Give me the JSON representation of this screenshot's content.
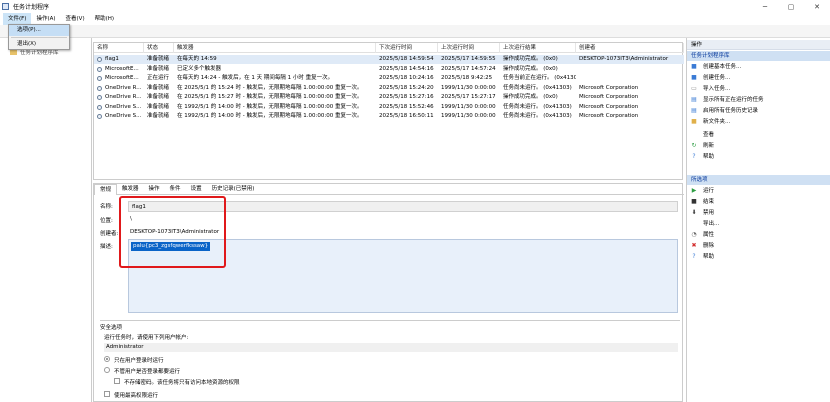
{
  "window": {
    "title": "任务计划程序"
  },
  "menubar": {
    "items": [
      "文件(F)",
      "操作(A)",
      "查看(V)",
      "帮助(H)"
    ]
  },
  "file_menu": {
    "items": [
      "选项(P)...",
      "退出(X)"
    ]
  },
  "tree": {
    "root": "任务计划程序库"
  },
  "tasklist": {
    "columns": [
      "名称",
      "状态",
      "触发器",
      "下次运行时间",
      "上次运行时间",
      "上次运行结果",
      "创建者"
    ],
    "rows": [
      [
        "flag1",
        "准备就绪",
        "在每天的 14:59",
        "2025/5/18 14:59:54",
        "2025/5/17 14:59:55",
        "操作成功完成。 (0x0)",
        "DESKTOP-1073IT3\\Administrator"
      ],
      [
        "MicrosoftE...",
        "准备就绪",
        "已定义多个触发器",
        "2025/5/18 14:54:16",
        "2025/5/17 14:57:24",
        "操作成功完成。 (0x0)",
        ""
      ],
      [
        "MicrosoftE...",
        "正在运行",
        "在每天的 14:24 - 触发后，在 1 天 期间每隔 1 小时 重复一次。",
        "2025/5/18 10:24:16",
        "2025/5/18 9:42:25",
        "任务当前正在运行。 (0x41301)",
        ""
      ],
      [
        "OneDrive R...",
        "准备就绪",
        "在 2025/5/1 的 15:24 时 - 触发后，无限期地每隔 1.00:00:00 重复一次。",
        "2025/5/18 15:24:20",
        "1999/11/30 0:00:00",
        "任务尚未运行。 (0x41303)",
        "Microsoft Corporation"
      ],
      [
        "OneDrive R...",
        "准备就绪",
        "在 2025/5/1 的 15:27 时 - 触发后，无限期地每隔 1.00:00:00 重复一次。",
        "2025/5/18 15:27:16",
        "2025/5/17 15:27:17",
        "操作成功完成。 (0x0)",
        "Microsoft Corporation"
      ],
      [
        "OneDrive S...",
        "准备就绪",
        "在 1992/5/1 的 14:00 时 - 触发后，无限期地每隔 1.00:00:00 重复一次。",
        "2025/5/18 15:52:46",
        "1999/11/30 0:00:00",
        "任务尚未运行。 (0x41303)",
        "Microsoft Corporation"
      ],
      [
        "OneDrive S...",
        "准备就绪",
        "在 1992/5/1 的 14:00 时 - 触发后，无限期地每隔 1.00:00:00 重复一次。",
        "2025/5/18 16:50:11",
        "1999/11/30 0:00:00",
        "任务尚未运行。 (0x41303)",
        "Microsoft Corporation"
      ]
    ]
  },
  "detail": {
    "tabs": [
      "常规",
      "触发器",
      "操作",
      "条件",
      "设置",
      "历史记录(已禁用)"
    ],
    "name_label": "名称:",
    "name_value": "flag1",
    "location_label": "位置:",
    "location_value": "\\",
    "author_label": "创建者:",
    "author_value": "DESKTOP-1073IT3\\Administrator",
    "desc_label": "描述:",
    "desc_value": "palu{pc3_zgsfqwerfkssaw}",
    "security_title": "安全选项",
    "security_prompt": "运行任务时，请使用下列用户帐户:",
    "security_user": "Administrator",
    "opt_logged_on": "只在用户登录时运行",
    "opt_any": "不管用户是否登录都要运行",
    "opt_no_store": "不存储密码。该任务将只有访问本地资源的权限",
    "opt_highest": "使用最高权限运行"
  },
  "actions": {
    "header": "操作",
    "library_title": "任务计划程序库",
    "library_items": [
      "创建基本任务...",
      "创建任务...",
      "导入任务...",
      "显示所有正在运行的任务",
      "启用所有任务历史记录",
      "新文件夹...",
      "查看",
      "刷新",
      "帮助"
    ],
    "selected_title": "所选项",
    "selected_items": [
      "运行",
      "结束",
      "禁用",
      "导出...",
      "属性",
      "删除",
      "帮助"
    ]
  }
}
